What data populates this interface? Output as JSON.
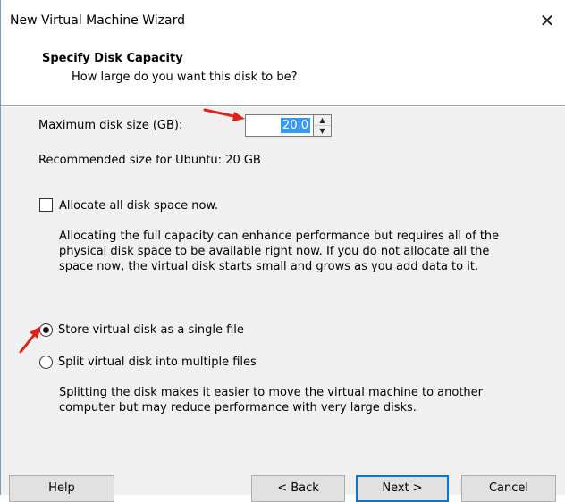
{
  "window": {
    "title": "New Virtual Machine Wizard",
    "close_glyph": "✕"
  },
  "header": {
    "title": "Specify Disk Capacity",
    "subtitle": "How large do you want this disk to be?"
  },
  "disk_size": {
    "label": "Maximum disk size (GB):",
    "value": "20.0",
    "recommended": "Recommended size for Ubuntu: 20 GB"
  },
  "allocate": {
    "checkbox_label": "Allocate all disk space now.",
    "checked": false,
    "description": [
      "Allocating the full capacity can enhance performance but requires all of the",
      "physical disk space to be available right now. If you do not allocate all the",
      "space now, the virtual disk starts small and grows as you add data to it."
    ]
  },
  "storage_options": {
    "single_label": "Store virtual disk as a single file",
    "split_label": "Split virtual disk into multiple files",
    "selected": "single",
    "split_description": [
      "Splitting the disk makes it easier to move the virtual machine to another",
      "computer but may reduce performance with very large disks."
    ]
  },
  "buttons": {
    "help": "Help",
    "back": "< Back",
    "next": "Next >",
    "cancel": "Cancel"
  },
  "colors": {
    "annotation_arrow": "#e0201b",
    "selection": "#3399ff",
    "default_button_border": "#0078d7"
  }
}
